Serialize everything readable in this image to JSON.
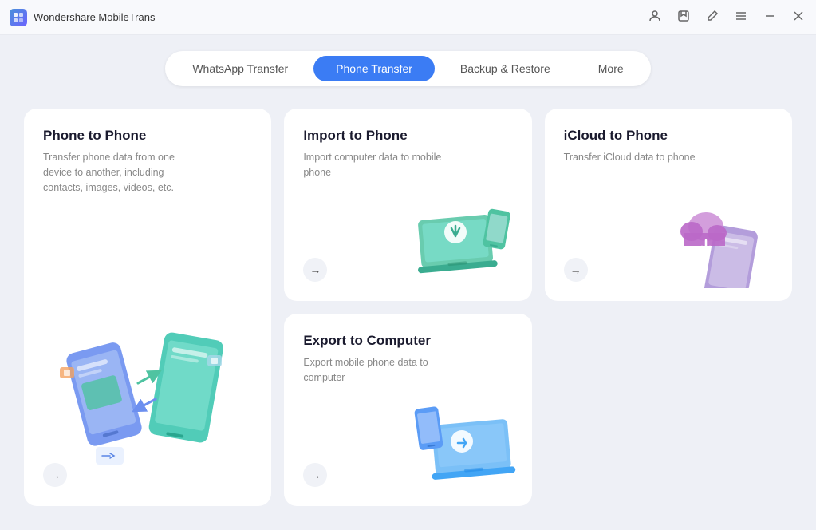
{
  "app": {
    "name": "Wondershare MobileTrans",
    "icon": "M"
  },
  "titlebar": {
    "controls": {
      "account": "👤",
      "bookmark": "🔖",
      "edit": "✏️",
      "menu": "☰",
      "minimize": "—",
      "close": "✕"
    }
  },
  "nav": {
    "tabs": [
      {
        "id": "whatsapp",
        "label": "WhatsApp Transfer",
        "active": false
      },
      {
        "id": "phone",
        "label": "Phone Transfer",
        "active": true
      },
      {
        "id": "backup",
        "label": "Backup & Restore",
        "active": false
      },
      {
        "id": "more",
        "label": "More",
        "active": false
      }
    ]
  },
  "cards": [
    {
      "id": "phone-to-phone",
      "title": "Phone to Phone",
      "description": "Transfer phone data from one device to another, including contacts, images, videos, etc.",
      "size": "large"
    },
    {
      "id": "import-to-phone",
      "title": "Import to Phone",
      "description": "Import computer data to mobile phone"
    },
    {
      "id": "icloud-to-phone",
      "title": "iCloud to Phone",
      "description": "Transfer iCloud data to phone"
    },
    {
      "id": "export-to-computer",
      "title": "Export to Computer",
      "description": "Export mobile phone data to computer"
    }
  ]
}
